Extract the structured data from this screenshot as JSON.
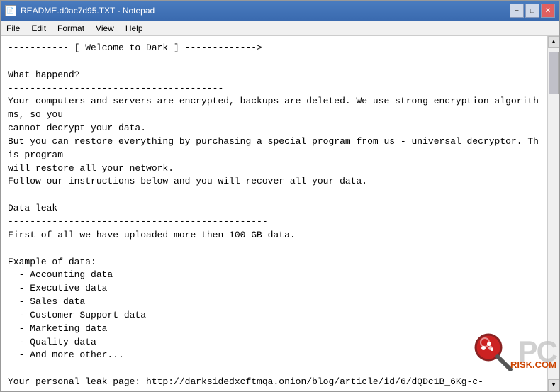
{
  "window": {
    "title": "README.d0ac7d95.TXT - Notepad",
    "icon": "📄"
  },
  "titlebar": {
    "minimize_label": "−",
    "maximize_label": "□",
    "close_label": "✕"
  },
  "menubar": {
    "items": [
      "File",
      "Edit",
      "Format",
      "View",
      "Help"
    ]
  },
  "content": {
    "text": "----------- [ Welcome to Dark ] ------------->\\n\\nWhat happend?\\n---------------------------------------\\nYour computers and servers are encrypted, backups are deleted. We use strong encryption algorithms, so you\\ncannot decrypt your data.\\nBut you can restore everything by purchasing a special program from us - universal decryptor. This program\\nwill restore all your network.\\nFollow our instructions below and you will recover all your data.\\n\\nData leak\\n-----------------------------------------------\\nFirst of all we have uploaded more then 100 GB data.\\n\\nExample of data:\\n  - Accounting data\\n  - Executive data\\n  - Sales data\\n  - Customer Support data\\n  - Marketing data\\n  - Quality data\\n  - And more other...\\n\\nYour personal leak page: http://darksidedxcftmqa.onion/blog/article/id/6/dQDc1B_6Kg-c-6fJesONyHoaKh9BtI8j9Wkw2inG8072jWaOcKbrxMWbPfKrUbHC\\nThe data is preloaded and will be automatically published if you do not pay.\\nAfter publication, your data will be available for at least 6 months on our tor cdn servers.\\n\\nWe are ready:\\n  - To provide you the evidence of stolen data\\n  - To give you universal decrypting tool for all encrypted files.\\n  - To delete all the stolen data."
  },
  "watermark": {
    "pc_text": "PC",
    "risk_text": "RISK.COM"
  }
}
